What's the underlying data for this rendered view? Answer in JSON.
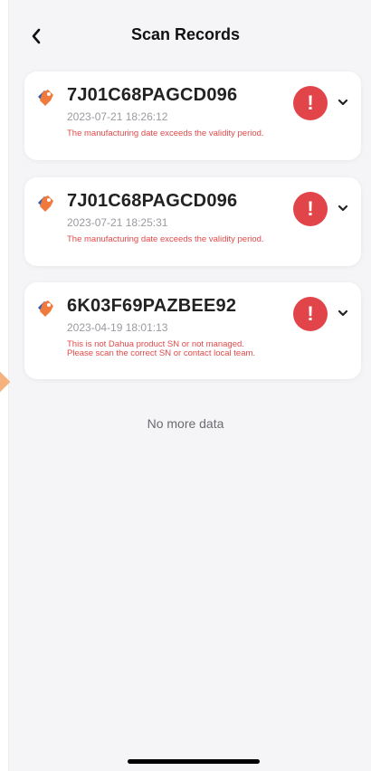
{
  "header": {
    "title": "Scan Records",
    "back_icon": "chevron-left-icon"
  },
  "records": [
    {
      "sn": "7J01C68PAGCD096",
      "datetime": "2023-07-21 18:26:12",
      "message": "The manufacturing date exceeds the validity period.",
      "status_icon": "alert-exclamation-icon",
      "expand_icon": "chevron-down-icon"
    },
    {
      "sn": "7J01C68PAGCD096",
      "datetime": "2023-07-21 18:25:31",
      "message": "The manufacturing date exceeds the validity period.",
      "status_icon": "alert-exclamation-icon",
      "expand_icon": "chevron-down-icon"
    },
    {
      "sn": "6K03F69PAZBEE92",
      "datetime": "2023-04-19 18:01:13",
      "message": "This is not Dahua product SN or not managed. Please scan the correct SN or contact local team.",
      "status_icon": "alert-exclamation-icon",
      "expand_icon": "chevron-down-icon"
    }
  ],
  "footer": {
    "no_more_text": "No more data"
  },
  "colors": {
    "accent_red": "#e24549",
    "error_text": "#e04a4a",
    "tag_orange": "#f07a3e",
    "tag_blue": "#2f5fb0",
    "background": "#f5f5f7"
  }
}
